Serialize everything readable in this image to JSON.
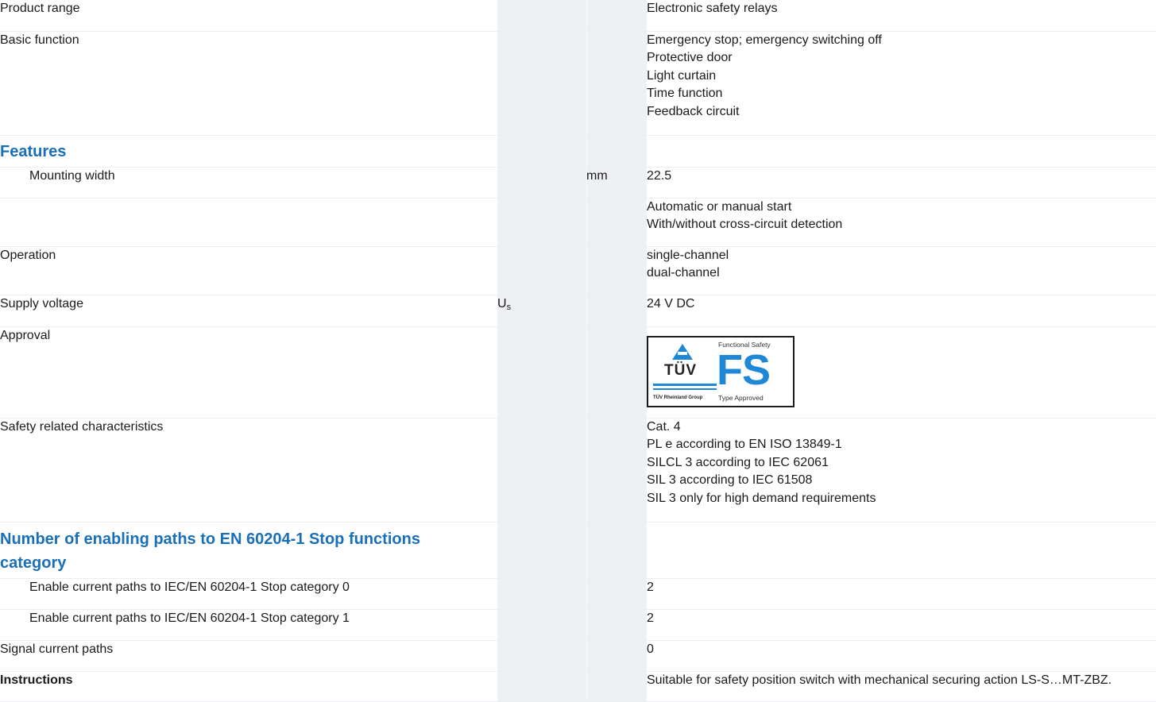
{
  "rows": {
    "product_range": {
      "label": "Product range",
      "value": "Electronic safety relays"
    },
    "basic_function": {
      "label": "Basic function",
      "values": [
        "Emergency stop; emergency switching off",
        "Protective door",
        "Light curtain",
        "Time function",
        "Feedback circuit"
      ]
    },
    "features_heading": "Features",
    "mounting_width": {
      "label": "Mounting width",
      "unit": "mm",
      "value": "22.5"
    },
    "start_options": {
      "values": [
        "Automatic or manual start",
        "With/without cross-circuit detection"
      ]
    },
    "operation": {
      "label": "Operation",
      "values": [
        "single-channel",
        "dual-channel"
      ]
    },
    "supply_voltage": {
      "label": "Supply voltage",
      "symbol": "U",
      "symbol_sub": "s",
      "value": "24 V DC"
    },
    "approval": {
      "label": "Approval",
      "logo": {
        "name": "tuv-rheinland-functional-safety-logo",
        "brand_text": "TÜV",
        "group_text": "TÜV Rheinland Group",
        "fs_top": "Functional Safety",
        "fs_text": "FS",
        "fs_bottom": "Type Approved",
        "brand_color": "#1f88d6"
      }
    },
    "safety_characteristics": {
      "label": "Safety related characteristics",
      "values": [
        "Cat. 4",
        "PL e according to EN ISO 13849-1",
        "SILCL 3 according to IEC 62061",
        "SIL 3 according to IEC 61508",
        "SIL 3 only for high demand requirements"
      ]
    },
    "enabling_heading": {
      "line1": "Number of enabling paths to EN 60204-1 Stop functions",
      "line2": "category"
    },
    "stop_cat0": {
      "label": "Enable current paths to IEC/EN 60204-1 Stop category 0",
      "value": "2"
    },
    "stop_cat1": {
      "label": "Enable current paths to IEC/EN 60204-1 Stop category 1",
      "value": "2"
    },
    "signal_paths": {
      "label": "Signal current paths",
      "value": "0"
    },
    "instructions": {
      "label": "Instructions",
      "value": "Suitable for safety position switch with mechanical securing action LS-S…MT-ZBZ."
    }
  },
  "colors": {
    "heading": "#1a6fb9",
    "stripe": "#eef0f4",
    "row_border": "#eceef2"
  }
}
